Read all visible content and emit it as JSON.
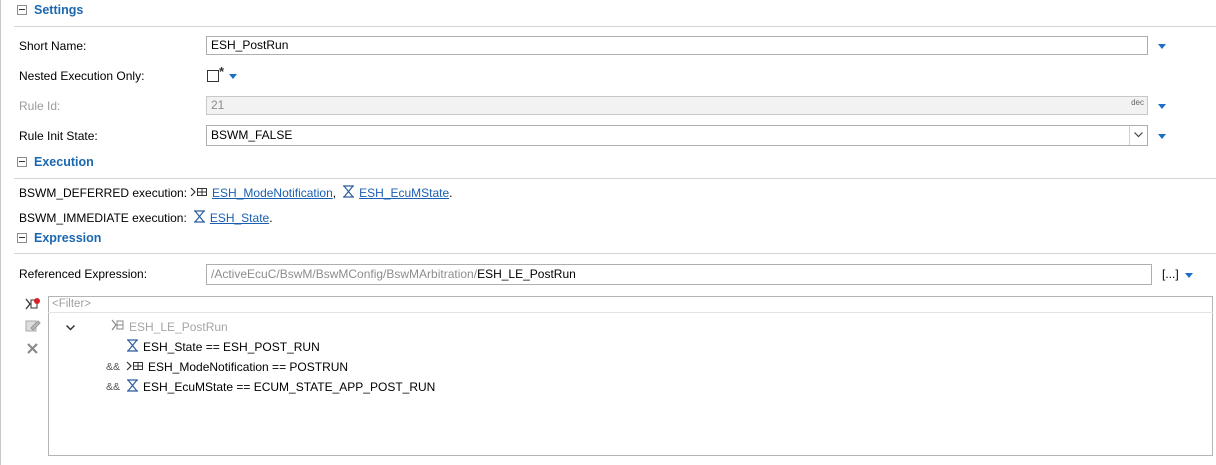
{
  "settings": {
    "title": "Settings",
    "short_name_label": "Short Name:",
    "short_name_value": "ESH_PostRun",
    "nested_label": "Nested Execution Only:",
    "nested_marker": "*",
    "rule_id_label": "Rule Id:",
    "rule_id_value": "21",
    "rule_id_unit": "dec",
    "rule_init_label": "Rule Init State:",
    "rule_init_value": "BSWM_FALSE"
  },
  "execution": {
    "title": "Execution",
    "deferred_label": "BSWM_DEFERRED execution:",
    "deferred_links": [
      "ESH_ModeNotification",
      "ESH_EcuMState"
    ],
    "immediate_label": "BSWM_IMMEDIATE execution:",
    "immediate_links": [
      "ESH_State"
    ],
    "separator": ",",
    "terminator": "."
  },
  "expression": {
    "title": "Expression",
    "ref_label": "Referenced Expression:",
    "ref_path_prefix": "/ActiveEcuC/BswM/BswMConfig/BswMArbitration/",
    "ref_path_name": "ESH_LE_PostRun",
    "browse_label": "[...]",
    "filter_placeholder": "<Filter>",
    "tree": {
      "root": "ESH_LE_PostRun",
      "children": [
        {
          "op": "",
          "text": "ESH_State == ESH_POST_RUN"
        },
        {
          "op": "&&",
          "text": "ESH_ModeNotification == POSTRUN"
        },
        {
          "op": "&&",
          "text": "ESH_EcuMState == ECUM_STATE_APP_POST_RUN"
        }
      ]
    }
  },
  "colors": {
    "accent": "#1b68b0",
    "link": "#1a5fb4",
    "arrow": "#1c6fc4"
  },
  "icons": [
    "minus-toggle-icon",
    "dropdown-arrow-icon",
    "mode-request-icon",
    "hourglass-icon",
    "add-icon",
    "edit-icon",
    "delete-icon",
    "chevron-down-icon",
    "logical-expression-icon"
  ]
}
